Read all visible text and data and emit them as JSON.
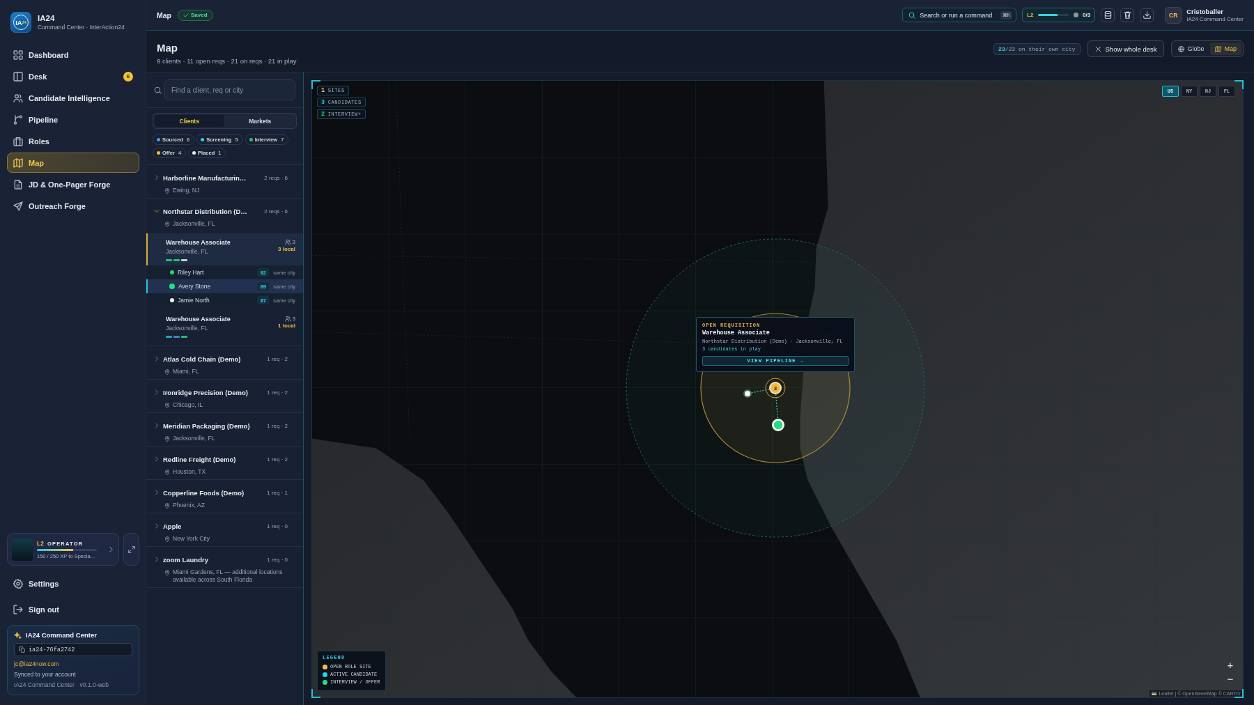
{
  "sidebar": {
    "logo": {
      "mark": "IA",
      "sup": "24"
    },
    "brand": "IA24",
    "tagline": "Command Center · InterAction24",
    "nav": [
      {
        "label": "Dashboard",
        "selected": false
      },
      {
        "label": "Desk",
        "selected": false,
        "badge": "6"
      },
      {
        "label": "Candidate Intelligence",
        "selected": false
      },
      {
        "label": "Pipeline",
        "selected": false
      },
      {
        "label": "Roles",
        "selected": false
      },
      {
        "label": "Map",
        "selected": true
      },
      {
        "label": "JD & One-Pager Forge",
        "selected": false
      },
      {
        "label": "Outreach Forge",
        "selected": false
      }
    ],
    "operator": {
      "tier": "L2",
      "rank": "OPERATOR",
      "level": 0.6,
      "caption": "150 / 250 XP to Specia…"
    },
    "links": [
      {
        "label": "Settings"
      },
      {
        "label": "Sign out"
      }
    ],
    "account": {
      "title": "IA24 Command Center",
      "workspace_id": "ia24-76fa2742",
      "email": "jc@ia24now.com",
      "sync": "Synced to your account",
      "version": "IA24 Command Center · v0.1.0-web"
    }
  },
  "topbar": {
    "page": "Map",
    "status": "Saved",
    "search": {
      "label": "Search or run a command",
      "shortcut": "⌘K"
    },
    "progress": {
      "badge": "L2",
      "level": 0.65,
      "count": "0/3"
    },
    "user": {
      "initials": "CR",
      "name": "Cristoballer",
      "org": "IA24 Command Center"
    }
  },
  "header": {
    "title": "Map",
    "summary": "9 clients · 11 open reqs · 21 on reqs · 21 in play",
    "coverage": {
      "highlight": "23",
      "rest": "/23 on their own city"
    },
    "reset_button": "Show whole desk",
    "views": [
      {
        "label": "Globe",
        "selected": false
      },
      {
        "label": "Map",
        "selected": true
      }
    ]
  },
  "list": {
    "search": {
      "placeholder": "Find a client, req or city"
    },
    "tabs": [
      {
        "label": "Clients",
        "selected": true
      },
      {
        "label": "Markets",
        "selected": false
      }
    ],
    "stages": [
      {
        "label": "Sourced",
        "count": "6",
        "color": "#3ba0f0"
      },
      {
        "label": "Screening",
        "count": "5",
        "color": "#22d3ee"
      },
      {
        "label": "Interview",
        "count": "7",
        "color": "#22c55e"
      },
      {
        "label": "Offer",
        "count": "4",
        "color": "#f5b942"
      },
      {
        "label": "Placed",
        "count": "1",
        "color": "#d9f3e6"
      }
    ],
    "clients": [
      {
        "name": "Harborline Manufacturin…",
        "meta": "2 reqs · 6",
        "location": "Ewing, NJ",
        "expanded": false
      },
      {
        "name": "Northstar Distribution (D…",
        "meta": "2 reqs · 6",
        "location": "Jacksonville, FL",
        "expanded": true,
        "reqs": [
          {
            "title": "Warehouse Associate",
            "location": "Jacksonville, FL",
            "count": "3",
            "local": "3 local",
            "selected": true,
            "pips": [
              {
                "color": "#1fbf73"
              },
              {
                "color": "#1fbf73"
              },
              {
                "color": "#b9d9cc"
              }
            ],
            "candidates": [
              {
                "name": "Riley Hart",
                "score": "82",
                "proximity": "same city",
                "color": "#22d67a",
                "selected": false
              },
              {
                "name": "Avery Stone",
                "score": "89",
                "proximity": "same city",
                "color": "#22e07f",
                "selected": true
              },
              {
                "name": "Jamie North",
                "score": "87",
                "proximity": "same city",
                "color": "#e0f7ec",
                "selected": false
              }
            ]
          },
          {
            "title": "Warehouse Associate",
            "location": "Jacksonville, FL",
            "count": "3",
            "local": "1 local",
            "selected": false,
            "pips": [
              {
                "color": "#1ea5c4"
              },
              {
                "color": "#3a86c8"
              },
              {
                "color": "#1fbf73"
              }
            ]
          }
        ]
      },
      {
        "name": "Atlas Cold Chain (Demo)",
        "meta": "1 req · 2",
        "location": "Miami, FL",
        "expanded": false
      },
      {
        "name": "Ironridge Precision (Demo)",
        "meta": "1 req · 2",
        "location": "Chicago, IL",
        "expanded": false
      },
      {
        "name": "Meridian Packaging (Demo)",
        "meta": "1 req · 2",
        "location": "Jacksonville, FL",
        "expanded": false
      },
      {
        "name": "Redline Freight (Demo)",
        "meta": "1 req · 2",
        "location": "Houston, TX",
        "expanded": false
      },
      {
        "name": "Copperline Foods (Demo)",
        "meta": "1 req · 1",
        "location": "Phoenix, AZ",
        "expanded": false
      },
      {
        "name": "Apple",
        "meta": "1 req · 0",
        "location": "New York City",
        "expanded": false
      },
      {
        "name": "zoom Laundry",
        "meta": "1 req · 0",
        "location": "Miami Gardens, FL — additional locations available across South Florida",
        "expanded": false
      }
    ]
  },
  "map": {
    "stats": [
      {
        "count": "1",
        "label": "SITES",
        "color": "#f2c04e"
      },
      {
        "count": "3",
        "label": "CANDIDATES",
        "color": "#22c9e0"
      },
      {
        "count": "2",
        "label": "INTERVIEW+",
        "color": "#22d67a"
      }
    ],
    "regions": [
      {
        "label": "US",
        "selected": true
      },
      {
        "label": "NY",
        "selected": false
      },
      {
        "label": "NJ",
        "selected": false
      },
      {
        "label": "FL",
        "selected": false
      }
    ],
    "popup": {
      "kicker": "OPEN REQUISITION",
      "title": "Warehouse Associate",
      "subtitle": "Northstar Distribution (Demo) · Jacksonville, FL",
      "detail": "3 candidates in play",
      "action": "VIEW PIPELINE →"
    },
    "site": {
      "count": "3"
    },
    "candidates": [
      {
        "color": "#e6fff3",
        "selected": false
      },
      {
        "color": "#22e07f",
        "selected": true
      }
    ],
    "legend": {
      "title": "LEGEND",
      "items": [
        {
          "label": "OPEN ROLE SITE",
          "color": "#f2c04e"
        },
        {
          "label": "ACTIVE CANDIDATE",
          "color": "#22d3ee"
        },
        {
          "label": "INTERVIEW / OFFER",
          "color": "#22e07f"
        }
      ]
    },
    "zoom": [
      "+",
      "−"
    ],
    "attribution": "Leaflet | © OpenStreetMap © CARTO"
  }
}
